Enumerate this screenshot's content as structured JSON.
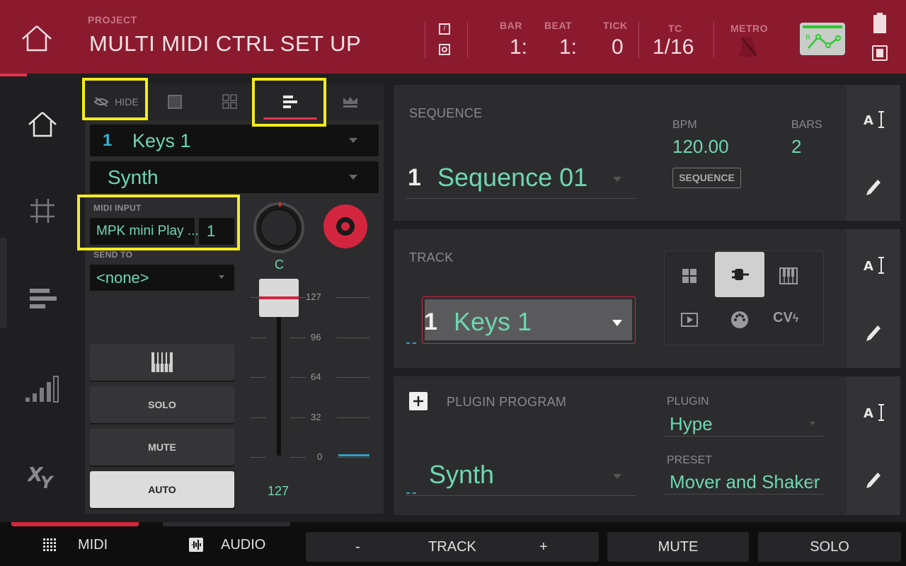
{
  "header": {
    "project_label": "PROJECT",
    "project_name": "MULTI MIDI CTRL SET UP",
    "bar_label": "BAR",
    "bar_value": "1:",
    "beat_label": "BEAT",
    "beat_value": "1:",
    "tick_label": "TICK",
    "tick_value": "0",
    "tc_label": "TC",
    "tc_value": "1/16",
    "metro_label": "METRO",
    "accent": "#8c1a2e"
  },
  "leftnav": {
    "items": [
      "home-icon",
      "grid-icon",
      "track-view-icon",
      "mixer-icon",
      "xy-icon"
    ]
  },
  "leftpanel": {
    "tabs": {
      "hide_label": "HIDE"
    },
    "track_number": "1",
    "track_name": "Keys 1",
    "program": "Synth",
    "midi_input_label": "MIDI INPUT",
    "midi_input_value": "MPK mini Play ...",
    "midi_channel": "1",
    "send_to_label": "SEND TO",
    "send_to_value": "<none>",
    "pan_value": "C",
    "fader_scale": [
      "127",
      "96",
      "64",
      "32",
      "0"
    ],
    "fader_value": "127",
    "solo_label": "SOLO",
    "mute_label": "MUTE",
    "auto_label": "AUTO"
  },
  "sequence_card": {
    "title": "SEQUENCE",
    "number": "1",
    "name": "Sequence 01",
    "bpm_label": "BPM",
    "bpm_value": "120.00",
    "bars_label": "BARS",
    "bars_value": "2",
    "sequence_button": "SEQUENCE"
  },
  "track_card": {
    "title": "TRACK",
    "number": "1",
    "name": "Keys 1",
    "cv_label": "CV"
  },
  "plugin_card": {
    "title": "PLUGIN PROGRAM",
    "program_name": "Synth",
    "plugin_label": "PLUGIN",
    "plugin_value": "Hype",
    "preset_label": "PRESET",
    "preset_value": "Mover and Shaker"
  },
  "bottombar": {
    "midi_label": "MIDI",
    "audio_label": "AUDIO",
    "minus_label": "-",
    "track_label": "TRACK",
    "plus_label": "+",
    "mute_label": "MUTE",
    "solo_label": "SOLO"
  }
}
